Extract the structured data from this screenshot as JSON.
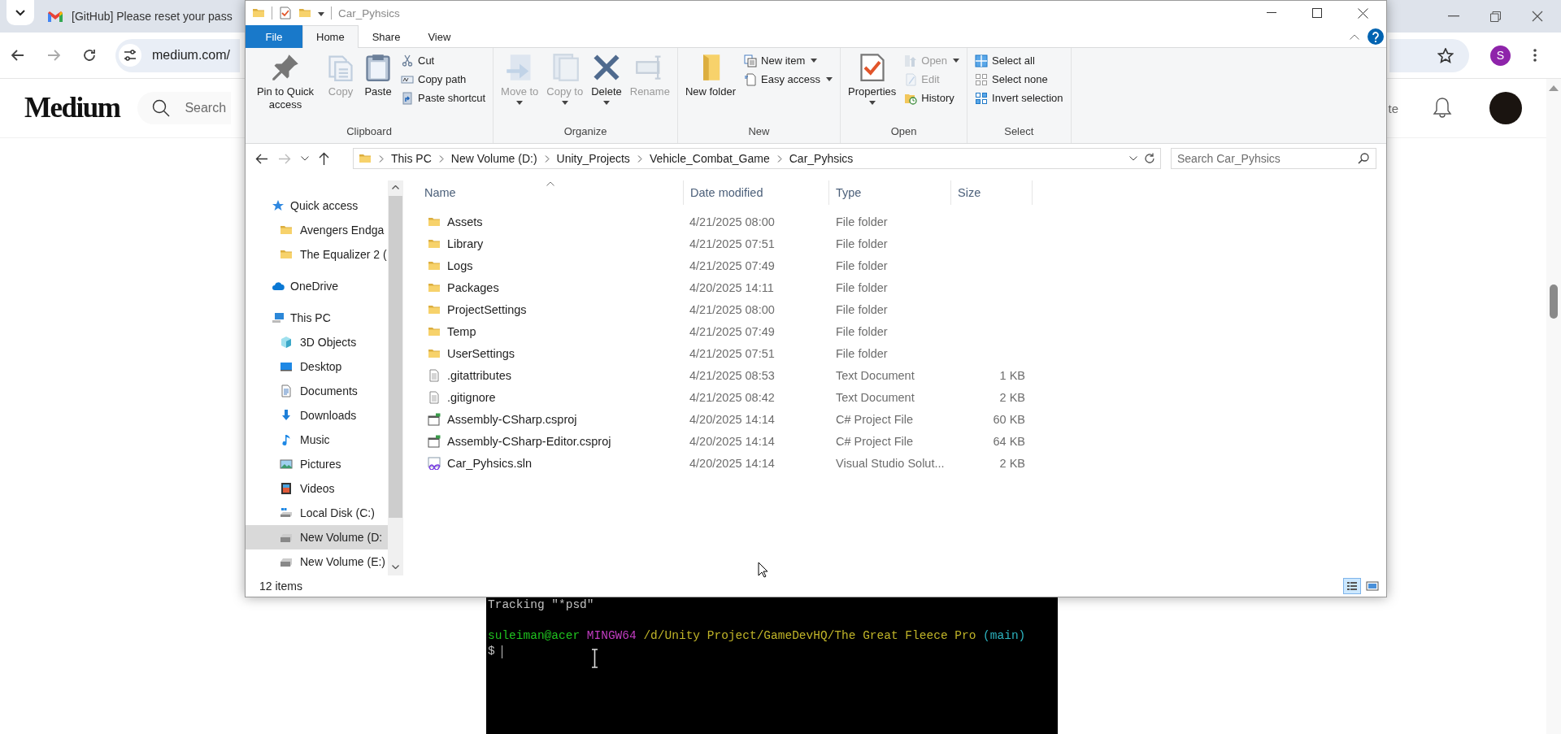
{
  "browser": {
    "tab": {
      "title": "[GitHub] Please reset your pass"
    },
    "address": "medium.com/",
    "site": {
      "logo": "Medium",
      "search_placeholder": "Search",
      "write_link": "te"
    },
    "profile_initial": "S"
  },
  "explorer": {
    "title": "Car_Pyhsics",
    "tabs": [
      {
        "label": "File",
        "kind": "file",
        "selected": false
      },
      {
        "label": "Home",
        "kind": "tab",
        "selected": true
      },
      {
        "label": "Share",
        "kind": "tab",
        "selected": false
      },
      {
        "label": "View",
        "kind": "tab",
        "selected": false
      }
    ],
    "ribbon": [
      {
        "label": "Clipboard",
        "commands": [
          {
            "label": "Pin to Quick access",
            "kind": "pin",
            "large": true,
            "dropdown": false,
            "disabled": false
          },
          {
            "label": "Copy",
            "kind": "copy",
            "large": true,
            "dropdown": false,
            "disabled": true
          },
          {
            "label": "Paste",
            "kind": "paste",
            "large": true,
            "dropdown": false,
            "disabled": false
          },
          {
            "label": "Cut",
            "kind": "cut",
            "large": false,
            "dropdown": false,
            "disabled": false
          },
          {
            "label": "Copy path",
            "kind": "copy-path",
            "large": false,
            "dropdown": false,
            "disabled": false
          },
          {
            "label": "Paste shortcut",
            "kind": "paste-shortcut",
            "large": false,
            "dropdown": false,
            "disabled": false
          }
        ]
      },
      {
        "label": "Organize",
        "commands": [
          {
            "label": "Move to",
            "kind": "move",
            "large": true,
            "dropdown": true,
            "disabled": true
          },
          {
            "label": "Copy to",
            "kind": "copy-to",
            "large": true,
            "dropdown": true,
            "disabled": true
          },
          {
            "label": "Delete",
            "kind": "delete",
            "large": true,
            "dropdown": true,
            "disabled": false
          },
          {
            "label": "Rename",
            "kind": "rename",
            "large": true,
            "dropdown": false,
            "disabled": true
          }
        ]
      },
      {
        "label": "New",
        "commands": [
          {
            "label": "New folder",
            "kind": "new-folder",
            "large": true,
            "dropdown": false,
            "disabled": false
          },
          {
            "label": "New item",
            "kind": "new-item",
            "large": false,
            "dropdown": true,
            "disabled": false
          },
          {
            "label": "Easy access",
            "kind": "easy-access",
            "large": false,
            "dropdown": true,
            "disabled": false
          }
        ]
      },
      {
        "label": "Open",
        "commands": [
          {
            "label": "Properties",
            "kind": "properties",
            "large": true,
            "dropdown": true,
            "disabled": false
          },
          {
            "label": "Open",
            "kind": "open",
            "large": false,
            "dropdown": true,
            "disabled": true
          },
          {
            "label": "Edit",
            "kind": "edit",
            "large": false,
            "dropdown": false,
            "disabled": true
          },
          {
            "label": "History",
            "kind": "history",
            "large": false,
            "dropdown": false,
            "disabled": false
          }
        ]
      },
      {
        "label": "Select",
        "commands": [
          {
            "label": "Select all",
            "kind": "select-all",
            "large": false,
            "dropdown": false,
            "disabled": false
          },
          {
            "label": "Select none",
            "kind": "select-none",
            "large": false,
            "dropdown": false,
            "disabled": false
          },
          {
            "label": "Invert selection",
            "kind": "invert",
            "large": false,
            "dropdown": false,
            "disabled": false
          }
        ]
      }
    ],
    "breadcrumbs": [
      "This PC",
      "New Volume (D:)",
      "Unity_Projects",
      "Vehicle_Combat_Game",
      "Car_Pyhsics"
    ],
    "search_placeholder": "Search Car_Pyhsics",
    "nav": [
      {
        "label": "Quick access",
        "kind": "star",
        "selected": false,
        "children": [
          {
            "label": "Avengers Endga",
            "kind": "folder",
            "selected": false
          },
          {
            "label": "The Equalizer 2 (",
            "kind": "folder",
            "selected": false
          }
        ]
      },
      {
        "label": "OneDrive",
        "kind": "cloud",
        "selected": false
      },
      {
        "label": "This PC",
        "kind": "pc",
        "selected": false,
        "children": [
          {
            "label": "3D Objects",
            "kind": "cube",
            "selected": false
          },
          {
            "label": "Desktop",
            "kind": "desktop",
            "selected": false
          },
          {
            "label": "Documents",
            "kind": "document",
            "selected": false
          },
          {
            "label": "Downloads",
            "kind": "download",
            "selected": false
          },
          {
            "label": "Music",
            "kind": "music",
            "selected": false
          },
          {
            "label": "Pictures",
            "kind": "picture",
            "selected": false
          },
          {
            "label": "Videos",
            "kind": "video",
            "selected": false
          },
          {
            "label": "Local Disk (C:)",
            "kind": "disk",
            "selected": false
          },
          {
            "label": "New Volume (D:",
            "kind": "drive",
            "selected": true
          },
          {
            "label": "New Volume (E:)",
            "kind": "drive",
            "selected": false
          }
        ]
      }
    ],
    "columns": [
      {
        "label": "Name",
        "sorted": true
      },
      {
        "label": "Date modified",
        "sorted": false
      },
      {
        "label": "Type",
        "sorted": false
      },
      {
        "label": "Size",
        "sorted": false
      }
    ],
    "files": [
      {
        "name": "Assets",
        "kind": "folder",
        "date": "4/21/2025 08:00",
        "type": "File folder"
      },
      {
        "name": "Library",
        "kind": "folder",
        "date": "4/21/2025 07:51",
        "type": "File folder"
      },
      {
        "name": "Logs",
        "kind": "folder",
        "date": "4/21/2025 07:49",
        "type": "File folder"
      },
      {
        "name": "Packages",
        "kind": "folder",
        "date": "4/20/2025 14:11",
        "type": "File folder"
      },
      {
        "name": "ProjectSettings",
        "kind": "folder",
        "date": "4/21/2025 08:00",
        "type": "File folder"
      },
      {
        "name": "Temp",
        "kind": "folder",
        "date": "4/21/2025 07:49",
        "type": "File folder"
      },
      {
        "name": "UserSettings",
        "kind": "folder",
        "date": "4/21/2025 07:51",
        "type": "File folder"
      },
      {
        "name": ".gitattributes",
        "kind": "text",
        "date": "4/21/2025 08:53",
        "type": "Text Document",
        "size": "1 KB"
      },
      {
        "name": ".gitignore",
        "kind": "text",
        "date": "4/21/2025 08:42",
        "type": "Text Document",
        "size": "2 KB"
      },
      {
        "name": "Assembly-CSharp.csproj",
        "kind": "csproj",
        "date": "4/20/2025 14:14",
        "type": "C# Project File",
        "size": "60 KB"
      },
      {
        "name": "Assembly-CSharp-Editor.csproj",
        "kind": "csproj",
        "date": "4/20/2025 14:14",
        "type": "C# Project File",
        "size": "64 KB"
      },
      {
        "name": "Car_Pyhsics.sln",
        "kind": "sln",
        "date": "4/20/2025 14:14",
        "type": "Visual Studio Solut...",
        "size": "2 KB"
      }
    ],
    "status": "12 items",
    "view_modes": [
      {
        "kind": "details",
        "selected": true
      },
      {
        "kind": "tiles",
        "selected": false
      }
    ]
  },
  "terminal": {
    "lines": [
      {
        "kind": "output",
        "segments": [
          {
            "text": "Tracking \"*psd\"",
            "color": "#c0c0c0"
          }
        ]
      },
      {
        "kind": "prompt",
        "segments": [
          {
            "text": "suleiman@acer",
            "color": "#1fc21f"
          },
          {
            "text": "MINGW64",
            "color": "#c03cc0"
          },
          {
            "text": "/d/Unity Project/GameDevHQ/The Great Fleece Pro",
            "color": "#c0b428"
          },
          {
            "text": "(main)",
            "color": "#2cb4c0"
          }
        ]
      },
      {
        "kind": "input",
        "segments": [
          {
            "text": "$",
            "color": "#c0c0c0"
          }
        ],
        "cursor": true
      }
    ]
  }
}
